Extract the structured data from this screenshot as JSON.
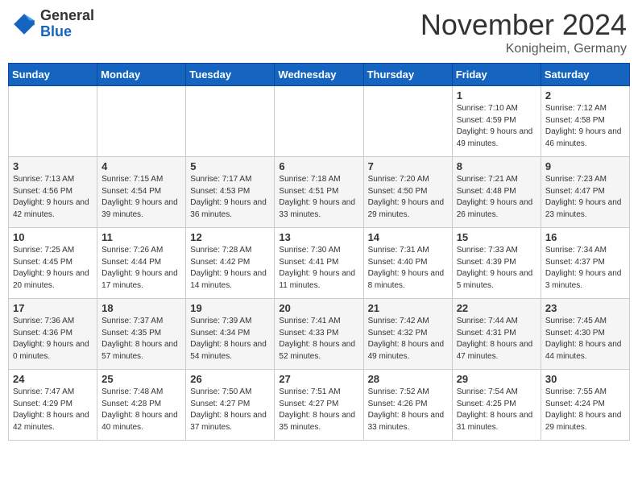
{
  "header": {
    "logo_general": "General",
    "logo_blue": "Blue",
    "title": "November 2024",
    "location": "Konigheim, Germany"
  },
  "days_of_week": [
    "Sunday",
    "Monday",
    "Tuesday",
    "Wednesday",
    "Thursday",
    "Friday",
    "Saturday"
  ],
  "weeks": [
    [
      {
        "day": "",
        "info": ""
      },
      {
        "day": "",
        "info": ""
      },
      {
        "day": "",
        "info": ""
      },
      {
        "day": "",
        "info": ""
      },
      {
        "day": "",
        "info": ""
      },
      {
        "day": "1",
        "info": "Sunrise: 7:10 AM\nSunset: 4:59 PM\nDaylight: 9 hours and 49 minutes."
      },
      {
        "day": "2",
        "info": "Sunrise: 7:12 AM\nSunset: 4:58 PM\nDaylight: 9 hours and 46 minutes."
      }
    ],
    [
      {
        "day": "3",
        "info": "Sunrise: 7:13 AM\nSunset: 4:56 PM\nDaylight: 9 hours and 42 minutes."
      },
      {
        "day": "4",
        "info": "Sunrise: 7:15 AM\nSunset: 4:54 PM\nDaylight: 9 hours and 39 minutes."
      },
      {
        "day": "5",
        "info": "Sunrise: 7:17 AM\nSunset: 4:53 PM\nDaylight: 9 hours and 36 minutes."
      },
      {
        "day": "6",
        "info": "Sunrise: 7:18 AM\nSunset: 4:51 PM\nDaylight: 9 hours and 33 minutes."
      },
      {
        "day": "7",
        "info": "Sunrise: 7:20 AM\nSunset: 4:50 PM\nDaylight: 9 hours and 29 minutes."
      },
      {
        "day": "8",
        "info": "Sunrise: 7:21 AM\nSunset: 4:48 PM\nDaylight: 9 hours and 26 minutes."
      },
      {
        "day": "9",
        "info": "Sunrise: 7:23 AM\nSunset: 4:47 PM\nDaylight: 9 hours and 23 minutes."
      }
    ],
    [
      {
        "day": "10",
        "info": "Sunrise: 7:25 AM\nSunset: 4:45 PM\nDaylight: 9 hours and 20 minutes."
      },
      {
        "day": "11",
        "info": "Sunrise: 7:26 AM\nSunset: 4:44 PM\nDaylight: 9 hours and 17 minutes."
      },
      {
        "day": "12",
        "info": "Sunrise: 7:28 AM\nSunset: 4:42 PM\nDaylight: 9 hours and 14 minutes."
      },
      {
        "day": "13",
        "info": "Sunrise: 7:30 AM\nSunset: 4:41 PM\nDaylight: 9 hours and 11 minutes."
      },
      {
        "day": "14",
        "info": "Sunrise: 7:31 AM\nSunset: 4:40 PM\nDaylight: 9 hours and 8 minutes."
      },
      {
        "day": "15",
        "info": "Sunrise: 7:33 AM\nSunset: 4:39 PM\nDaylight: 9 hours and 5 minutes."
      },
      {
        "day": "16",
        "info": "Sunrise: 7:34 AM\nSunset: 4:37 PM\nDaylight: 9 hours and 3 minutes."
      }
    ],
    [
      {
        "day": "17",
        "info": "Sunrise: 7:36 AM\nSunset: 4:36 PM\nDaylight: 9 hours and 0 minutes."
      },
      {
        "day": "18",
        "info": "Sunrise: 7:37 AM\nSunset: 4:35 PM\nDaylight: 8 hours and 57 minutes."
      },
      {
        "day": "19",
        "info": "Sunrise: 7:39 AM\nSunset: 4:34 PM\nDaylight: 8 hours and 54 minutes."
      },
      {
        "day": "20",
        "info": "Sunrise: 7:41 AM\nSunset: 4:33 PM\nDaylight: 8 hours and 52 minutes."
      },
      {
        "day": "21",
        "info": "Sunrise: 7:42 AM\nSunset: 4:32 PM\nDaylight: 8 hours and 49 minutes."
      },
      {
        "day": "22",
        "info": "Sunrise: 7:44 AM\nSunset: 4:31 PM\nDaylight: 8 hours and 47 minutes."
      },
      {
        "day": "23",
        "info": "Sunrise: 7:45 AM\nSunset: 4:30 PM\nDaylight: 8 hours and 44 minutes."
      }
    ],
    [
      {
        "day": "24",
        "info": "Sunrise: 7:47 AM\nSunset: 4:29 PM\nDaylight: 8 hours and 42 minutes."
      },
      {
        "day": "25",
        "info": "Sunrise: 7:48 AM\nSunset: 4:28 PM\nDaylight: 8 hours and 40 minutes."
      },
      {
        "day": "26",
        "info": "Sunrise: 7:50 AM\nSunset: 4:27 PM\nDaylight: 8 hours and 37 minutes."
      },
      {
        "day": "27",
        "info": "Sunrise: 7:51 AM\nSunset: 4:27 PM\nDaylight: 8 hours and 35 minutes."
      },
      {
        "day": "28",
        "info": "Sunrise: 7:52 AM\nSunset: 4:26 PM\nDaylight: 8 hours and 33 minutes."
      },
      {
        "day": "29",
        "info": "Sunrise: 7:54 AM\nSunset: 4:25 PM\nDaylight: 8 hours and 31 minutes."
      },
      {
        "day": "30",
        "info": "Sunrise: 7:55 AM\nSunset: 4:24 PM\nDaylight: 8 hours and 29 minutes."
      }
    ]
  ]
}
